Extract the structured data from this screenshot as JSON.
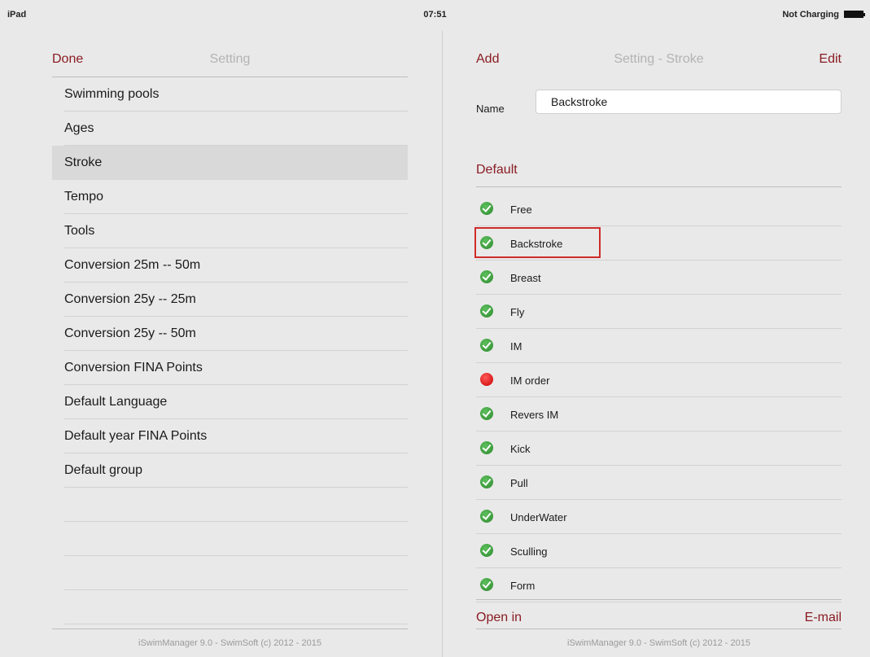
{
  "status_bar": {
    "device": "iPad",
    "time": "07:51",
    "charging": "Not Charging"
  },
  "left": {
    "nav_left": "Done",
    "title": "Setting",
    "items": [
      "Swimming pools",
      "Ages",
      "Stroke",
      "Tempo",
      "Tools",
      "Conversion 25m -- 50m",
      "Conversion 25y -- 25m",
      "Conversion 25y -- 50m",
      "Conversion FINA Points",
      "Default Language",
      "Default year FINA Points",
      "Default group",
      "",
      "",
      "",
      ""
    ],
    "selected": "Stroke",
    "footer": "iSwimManager 9.0 - SwimSoft (c) 2012 - 2015"
  },
  "right": {
    "nav_left": "Add",
    "title": "Setting - Stroke",
    "nav_right": "Edit",
    "name_label": "Name",
    "name_value": "Backstroke",
    "section": "Default",
    "strokes": [
      {
        "label": "Free",
        "status": "ok"
      },
      {
        "label": "Backstroke",
        "status": "ok"
      },
      {
        "label": "Breast",
        "status": "ok"
      },
      {
        "label": "Fly",
        "status": "ok"
      },
      {
        "label": "IM",
        "status": "ok"
      },
      {
        "label": "IM order",
        "status": "bad"
      },
      {
        "label": "Revers IM",
        "status": "ok"
      },
      {
        "label": "Kick",
        "status": "ok"
      },
      {
        "label": "Pull",
        "status": "ok"
      },
      {
        "label": "UnderWater",
        "status": "ok"
      },
      {
        "label": "Sculling",
        "status": "ok"
      },
      {
        "label": "Form",
        "status": "ok"
      }
    ],
    "open_in": "Open in",
    "email": "E-mail",
    "footer": "iSwimManager 9.0 - SwimSoft (c) 2012 - 2015"
  },
  "colors": {
    "accent": "#8a1c23",
    "ok": "#3a9a3a",
    "bad": "#e00000",
    "highlight": "#d02b2b"
  }
}
